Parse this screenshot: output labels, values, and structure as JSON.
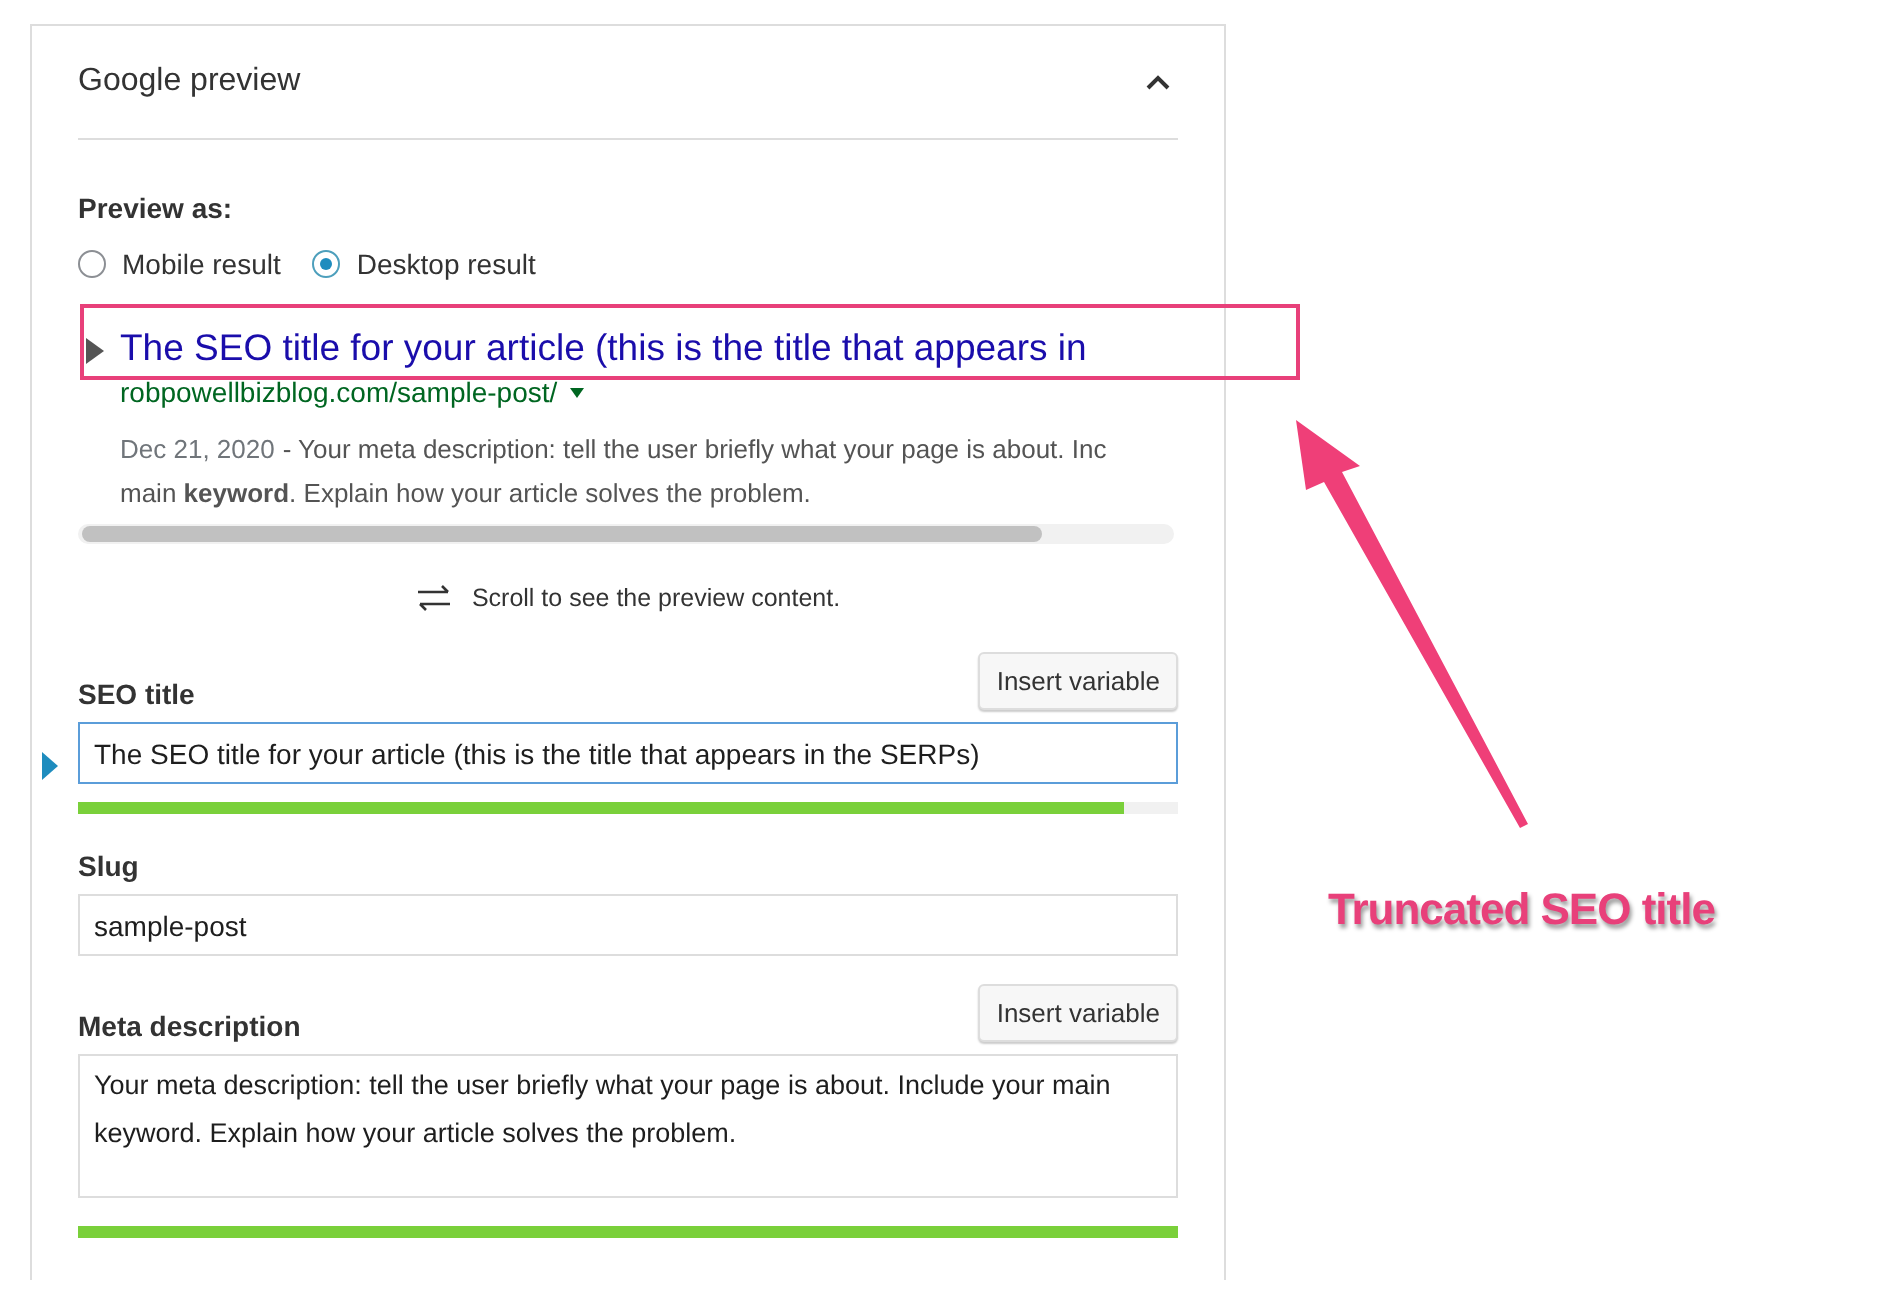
{
  "panel": {
    "title": "Google preview",
    "expanded": true
  },
  "preview": {
    "label": "Preview as:",
    "modes": [
      {
        "label": "Mobile result",
        "selected": false
      },
      {
        "label": "Desktop result",
        "selected": true
      }
    ],
    "snippet": {
      "title": "The SEO title for your article (this is the title that appears in",
      "url": "robpowellbizblog.com/sample-post/",
      "date": "Dec 21, 2020",
      "lines": [
        "- Your meta description: tell the user briefly what your page is about. Inc",
        "main **keyword**. Explain how your article solves the problem."
      ]
    },
    "scroll_hint": "Scroll to see the preview content."
  },
  "fields": [
    {
      "kind": "input",
      "label": "SEO title",
      "button": "Insert variable",
      "value": "The SEO title for your article (this is the title that appears in the SERPs)",
      "focused": true,
      "level": 0.95
    },
    {
      "kind": "input",
      "label": "Slug",
      "value": "sample-post",
      "focused": false
    },
    {
      "kind": "textarea",
      "label": "Meta description",
      "button": "Insert variable",
      "value": "Your meta description: tell the user briefly what your page is about. Include your main keyword. Explain how your article solves the problem.",
      "focused": false,
      "level": 1
    }
  ],
  "annotation": {
    "text": "Truncated SEO title"
  }
}
